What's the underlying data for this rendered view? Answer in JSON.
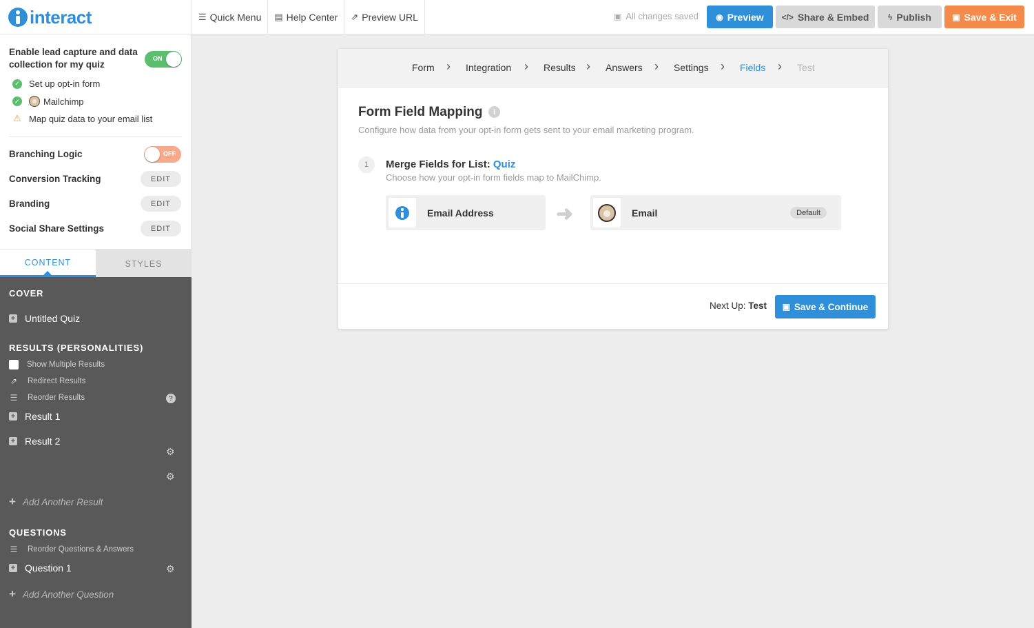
{
  "app": {
    "logo_text": "interact"
  },
  "topnav": {
    "items": [
      {
        "label": "Quick Menu",
        "icon": "menu-icon"
      },
      {
        "label": "Help Center",
        "icon": "book-icon"
      },
      {
        "label": "Preview URL",
        "icon": "external-link-icon"
      }
    ],
    "saved_status": "All changes saved",
    "preview_label": "Preview",
    "share_label": "Share & Embed",
    "publish_label": "Publish",
    "exit_label": "Save & Exit"
  },
  "sidebar": {
    "lead_capture_label": "Enable lead capture and data collection for my quiz",
    "lead_toggle": "ON",
    "checklist": [
      {
        "label": "Set up opt-in form",
        "status": "done"
      },
      {
        "label": "Mailchimp",
        "status": "done"
      },
      {
        "label": "Map quiz data to your email list",
        "status": "warning"
      }
    ],
    "branching_label": "Branching Logic",
    "branching_toggle": "OFF",
    "conversion_label": "Conversion Tracking",
    "branding_label": "Branding",
    "social_label": "Social Share Settings",
    "edit_label": "EDIT",
    "tabs": {
      "content": "CONTENT",
      "styles": "STYLES"
    },
    "cover_head": "COVER",
    "cover_item": "Untitled Quiz",
    "results_head": "RESULTS (PERSONALITIES)",
    "show_multiple": "Show Multiple Results",
    "redirect_results": "Redirect Results",
    "reorder_results": "Reorder Results",
    "results": [
      "Result 1",
      "Result 2"
    ],
    "add_result": "Add Another Result",
    "questions_head": "QUESTIONS",
    "reorder_questions": "Reorder Questions & Answers",
    "questions": [
      "Question 1"
    ],
    "add_question": "Add Another Question"
  },
  "main": {
    "breadcrumbs": [
      "Form",
      "Integration",
      "Results",
      "Answers",
      "Settings",
      "Fields",
      "Test"
    ],
    "active_crumb": "Fields",
    "title": "Form Field Mapping",
    "description": "Configure how data from your opt-in form gets sent to your email marketing program.",
    "step_number": "1",
    "merge_prefix": "Merge Fields for List: ",
    "list_name": "Quiz",
    "merge_desc": "Choose how your opt-in form fields map to MailChimp.",
    "source_field": "Email Address",
    "target_field": "Email",
    "default_badge": "Default",
    "next_up_prefix": "Next Up: ",
    "next_up_value": "Test",
    "save_continue": "Save & Continue"
  },
  "colors": {
    "accent": "#2f8fd8",
    "orange": "#f48b4b",
    "green": "#5cbf70",
    "sidebar_dark": "#595959"
  }
}
